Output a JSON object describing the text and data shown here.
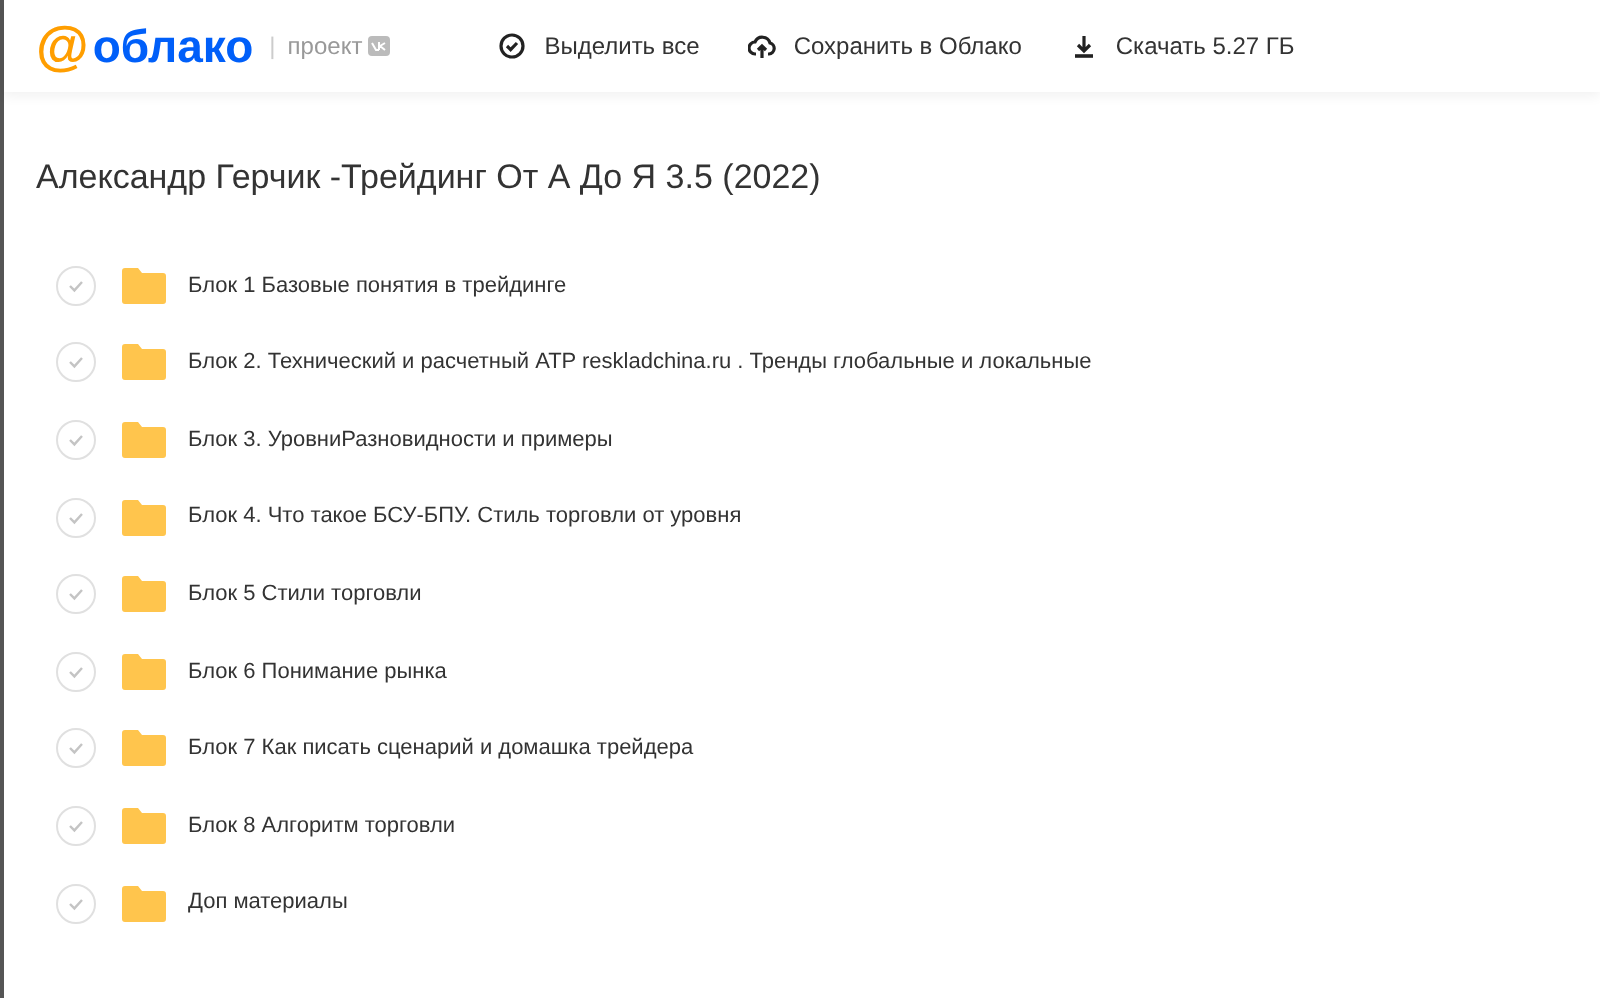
{
  "header": {
    "logo_mark": "@",
    "logo_text": "облако",
    "separator": "|",
    "project_label": "проект",
    "actions": [
      {
        "kind": "select",
        "label": "Выделить все"
      },
      {
        "kind": "save",
        "label": "Сохранить в Облако"
      },
      {
        "kind": "download",
        "label": "Скачать 5.27 ГБ"
      }
    ]
  },
  "folder": {
    "title": "Александр Герчик -Трейдинг От А До Я 3.5 (2022)",
    "items": [
      {
        "name": "Блок 1 Базовые понятия в трейдинге",
        "checked": false
      },
      {
        "name": "Блок 2. Технический и расчетный ATP reskladchina.ru . Тренды глобальные и локальные",
        "checked": false
      },
      {
        "name": "Блок 3. УровниРазновидности и примеры",
        "checked": false
      },
      {
        "name": "Блок 4. Что такое БСУ-БПУ. Стиль торговли от уровня",
        "checked": false
      },
      {
        "name": "Блок 5 Стили торговли",
        "checked": false
      },
      {
        "name": "Блок 6 Понимание рынка",
        "checked": false
      },
      {
        "name": "Блок 7 Как писать сценарий и домашка трейдера",
        "checked": false
      },
      {
        "name": "Блок 8 Алгоритм торговли",
        "checked": false
      },
      {
        "name": "Доп материалы",
        "checked": false
      }
    ]
  }
}
